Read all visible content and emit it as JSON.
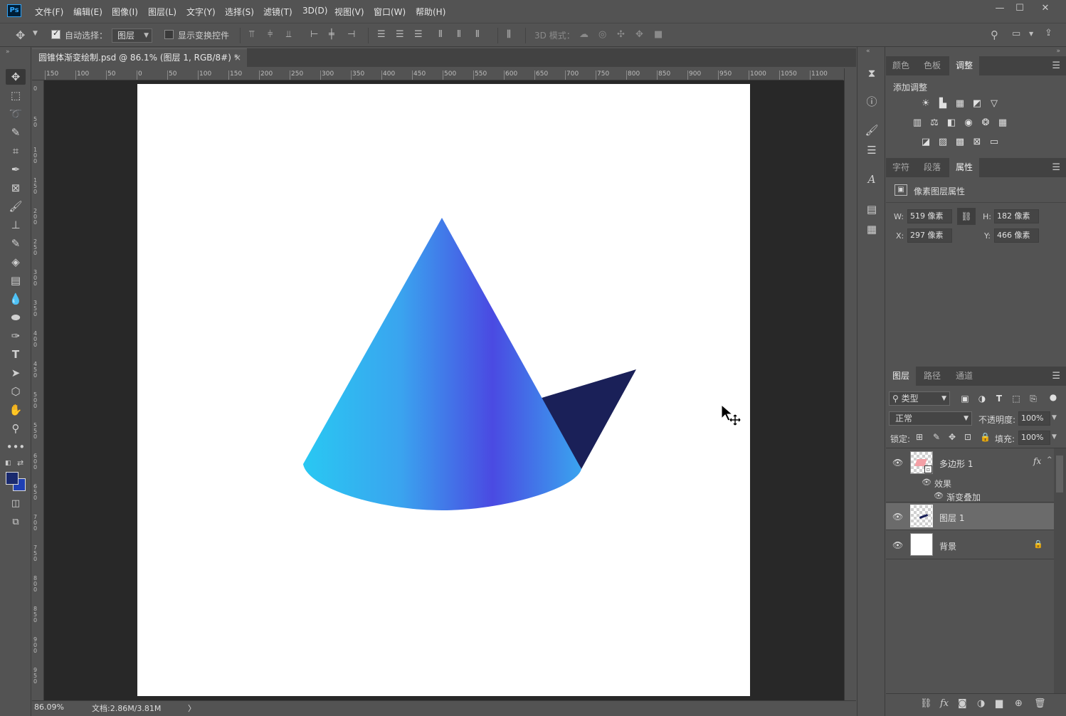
{
  "app": {
    "logo": "Ps"
  },
  "menu": [
    "文件(F)",
    "编辑(E)",
    "图像(I)",
    "图层(L)",
    "文字(Y)",
    "选择(S)",
    "滤镜(T)",
    "3D(D)",
    "视图(V)",
    "窗口(W)",
    "帮助(H)"
  ],
  "window_controls": {
    "minimize": "—",
    "restore": "☐",
    "close": "✕"
  },
  "options_bar": {
    "auto_select_label": "自动选择：",
    "auto_select_checked": true,
    "auto_select_target": "图层",
    "show_transform_label": "显示变换控件",
    "show_transform_checked": false,
    "mode_3d_label": "3D 模式："
  },
  "document": {
    "tab_title": "圆锥体渐变绘制.psd @ 86.1% (图层 1, RGB/8#) *",
    "close": "×",
    "ruler_top": [
      "150",
      "100",
      "50",
      "0",
      "50",
      "100",
      "150",
      "200",
      "250",
      "300",
      "350",
      "400",
      "450",
      "500",
      "550",
      "600",
      "650",
      "700",
      "750",
      "800",
      "850",
      "900",
      "950",
      "1000",
      "1050",
      "1100"
    ],
    "ruler_left": [
      "0",
      "50",
      "100",
      "150",
      "200",
      "250",
      "300",
      "350",
      "400",
      "450",
      "500",
      "550",
      "600",
      "650",
      "700",
      "750",
      "800",
      "850",
      "900",
      "950"
    ],
    "cone_colors": {
      "light": "#29c8f2",
      "mid": "#3aa4ef",
      "deep": "#4a4ae2",
      "shadow": "#1a2058"
    }
  },
  "status": {
    "zoom": "86.09%",
    "doc_size": "文档:2.86M/3.81M",
    "arrow": "〉"
  },
  "tools": {
    "foreground_color": "#1a2a6e",
    "background_color": "#1f3fb3"
  },
  "adjustments_panel": {
    "tabs": [
      "颜色",
      "色板",
      "调整"
    ],
    "active_tab": "调整",
    "heading": "添加调整"
  },
  "properties_panel": {
    "tabs": [
      "字符",
      "段落",
      "属性"
    ],
    "active_tab": "属性",
    "title": "像素图层属性",
    "w_label": "W:",
    "w_value": "519 像素",
    "h_label": "H:",
    "h_value": "182 像素",
    "x_label": "X:",
    "x_value": "297 像素",
    "y_label": "Y:",
    "y_value": "466 像素"
  },
  "layers_panel": {
    "tabs": [
      "图层",
      "路径",
      "通道"
    ],
    "active_tab": "图层",
    "filter_label": "类型",
    "blend_mode": "正常",
    "opacity_label": "不透明度:",
    "opacity_value": "100%",
    "lock_label": "锁定:",
    "fill_label": "填充:",
    "fill_value": "100%",
    "layers": [
      {
        "name": "多边形 1",
        "fx": "fx",
        "effects_label": "效果",
        "effect": "渐变叠加"
      },
      {
        "name": "图层 1",
        "selected": true
      },
      {
        "name": "背景",
        "locked": true
      }
    ]
  }
}
